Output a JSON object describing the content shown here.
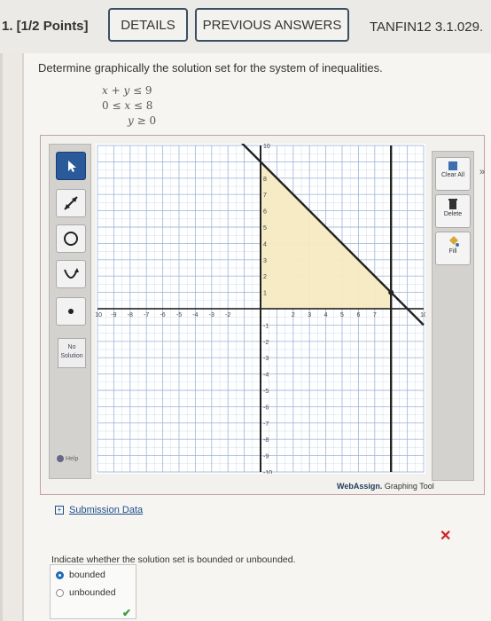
{
  "header": {
    "question_number": "1. [1/2 Points]",
    "details_label": "DETAILS",
    "previous_answers_label": "PREVIOUS ANSWERS",
    "question_code": "TANFIN12 3.1.029."
  },
  "question": {
    "prompt": "Determine graphically the solution set for the system of inequalities.",
    "inequalities": [
      {
        "lhs": "x + y",
        "op": "≤",
        "rhs": "9"
      },
      {
        "lhs": "0 ≤ x",
        "op": "≤",
        "rhs": "8"
      },
      {
        "lhs": "y",
        "op": "≥",
        "rhs": "0"
      }
    ]
  },
  "tools": {
    "no_solution_label": "No Solution",
    "help_label": "Help"
  },
  "right_panel": {
    "clear_all_label": "Clear All",
    "delete_label": "Delete",
    "fill_label": "Fill"
  },
  "graph": {
    "x_range": [
      -10,
      10
    ],
    "y_range": [
      -10,
      10
    ],
    "x_tick_labels": [
      "-10",
      "-9",
      "-8",
      "-7",
      "-6",
      "-5",
      "-4",
      "-3",
      "-2",
      "",
      "2",
      "3",
      "4",
      "5",
      "6",
      "7",
      "",
      "10"
    ],
    "y_tick_labels": [
      "10",
      "8",
      "7",
      "6",
      "5",
      "4",
      "3",
      "2",
      "1",
      "-1",
      "-2",
      "-3",
      "-4",
      "-5",
      "-6",
      "-7",
      "-8",
      "-9",
      "-10"
    ],
    "lines": [
      "x + y = 9",
      "x = 8",
      "x = 0",
      "y = 0"
    ],
    "shaded_region": [
      [
        0,
        0
      ],
      [
        8,
        0
      ],
      [
        8,
        1
      ],
      [
        0,
        9
      ]
    ],
    "points": [
      [
        8,
        1
      ]
    ],
    "colors": {
      "shade": "#f6eac2",
      "line": "#222222",
      "grid": "#9fb6d9"
    }
  },
  "footer": {
    "tool_brand": "WebAssign.",
    "tool_name": "Graphing Tool",
    "submission_data_label": "Submission Data",
    "submission_toggle": "+",
    "incorrect_mark": "✕",
    "correct_mark": "✔"
  },
  "question2": {
    "prompt": "Indicate whether the solution set is bounded or unbounded.",
    "options": [
      "bounded",
      "unbounded"
    ],
    "selected": "bounded"
  }
}
